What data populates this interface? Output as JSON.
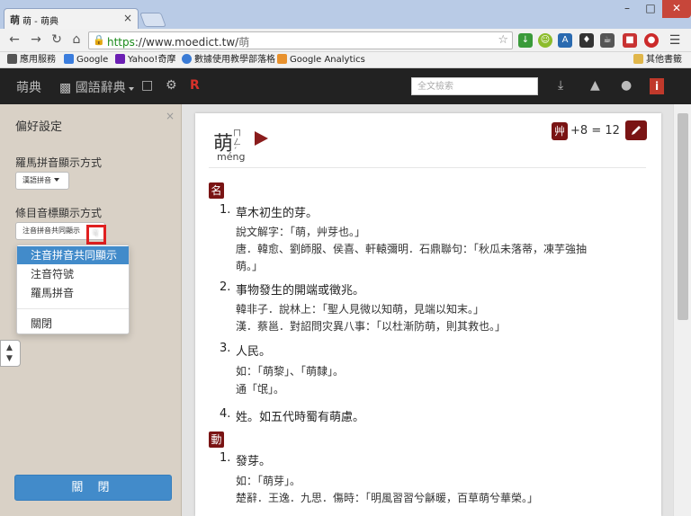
{
  "browser": {
    "tab_icon": "萌",
    "tab_title": "萌 - 萌典",
    "tab_close": "×",
    "url_scheme": "https",
    "url_host": "://www.moedict.tw/",
    "url_path": "萌",
    "win_min": "–",
    "win_max": "□",
    "win_close": "✕"
  },
  "bookmarks": {
    "items": [
      {
        "label": "應用服務",
        "color": "#555555",
        "icon": "apps-grid-icon"
      },
      {
        "label": "Google",
        "color": "#3b7ddd",
        "icon": "google-icon"
      },
      {
        "label": "Yahoo!奇摩",
        "color": "#6b1fb3",
        "icon": "yahoo-icon"
      },
      {
        "label": "數據使用教學部落格",
        "color": "#3a7bd5",
        "icon": "globe-icon"
      },
      {
        "label": "Google Analytics",
        "color": "#e8912d",
        "icon": "analytics-icon"
      }
    ],
    "other": "其他書籤"
  },
  "site": {
    "logo": "萌典",
    "dict": "國語辭典",
    "search_placeholder": "全文檢索",
    "radical_icon": "R",
    "info_icon": "i"
  },
  "prefs": {
    "title": "偏好設定",
    "close": "×",
    "romanization_label": "羅馬拼音顯示方式",
    "romanization_value": "漢語拼音",
    "phonetic_label": "條目音標顯示方式",
    "phonetic_value": "注音拼音共同顯示",
    "menu": [
      "注音拼音共同顯示",
      "注音符號",
      "羅馬拼音",
      "關閉"
    ],
    "close_button": "關 閉"
  },
  "entry": {
    "headword": "萌",
    "bopomofo": "ㄇㄥˊ",
    "pinyin": "méng",
    "radical": "艸",
    "stroke_extra": "+8",
    "equals": "=",
    "stroke_total": "12",
    "pos_noun": "名",
    "pos_verb": "動",
    "noun_defs": [
      {
        "num": "1.",
        "text": "草木初生的芽。",
        "quotes": [
          "說文解字：「萌，艸芽也。」",
          "唐．韓愈、劉師服、侯喜、軒轅彌明．石鼎聯句：「秋瓜未落蒂，凍芋強抽",
          "萌。」"
        ]
      },
      {
        "num": "2.",
        "text": "事物發生的開端或徵兆。",
        "quotes": [
          "韓非子．說林上：「聖人見微以知萌，見端以知末。」",
          "漢．蔡邕．對詔問灾異八事：「以杜漸防萌，則其救也。」"
        ]
      },
      {
        "num": "3.",
        "text": "人民。",
        "quotes": [
          "如：「萌黎」、「萌隸」。",
          "通「氓」。"
        ]
      },
      {
        "num": "4.",
        "text": "姓。如五代時蜀有萌慮。",
        "quotes": []
      }
    ],
    "verb_defs": [
      {
        "num": "1.",
        "text": "發芽。",
        "quotes": [
          "如：「萌芽」。",
          "楚辭．王逸．九思．傷時：「明風習習兮龢暖，百草萌兮華榮。」"
        ]
      }
    ]
  }
}
